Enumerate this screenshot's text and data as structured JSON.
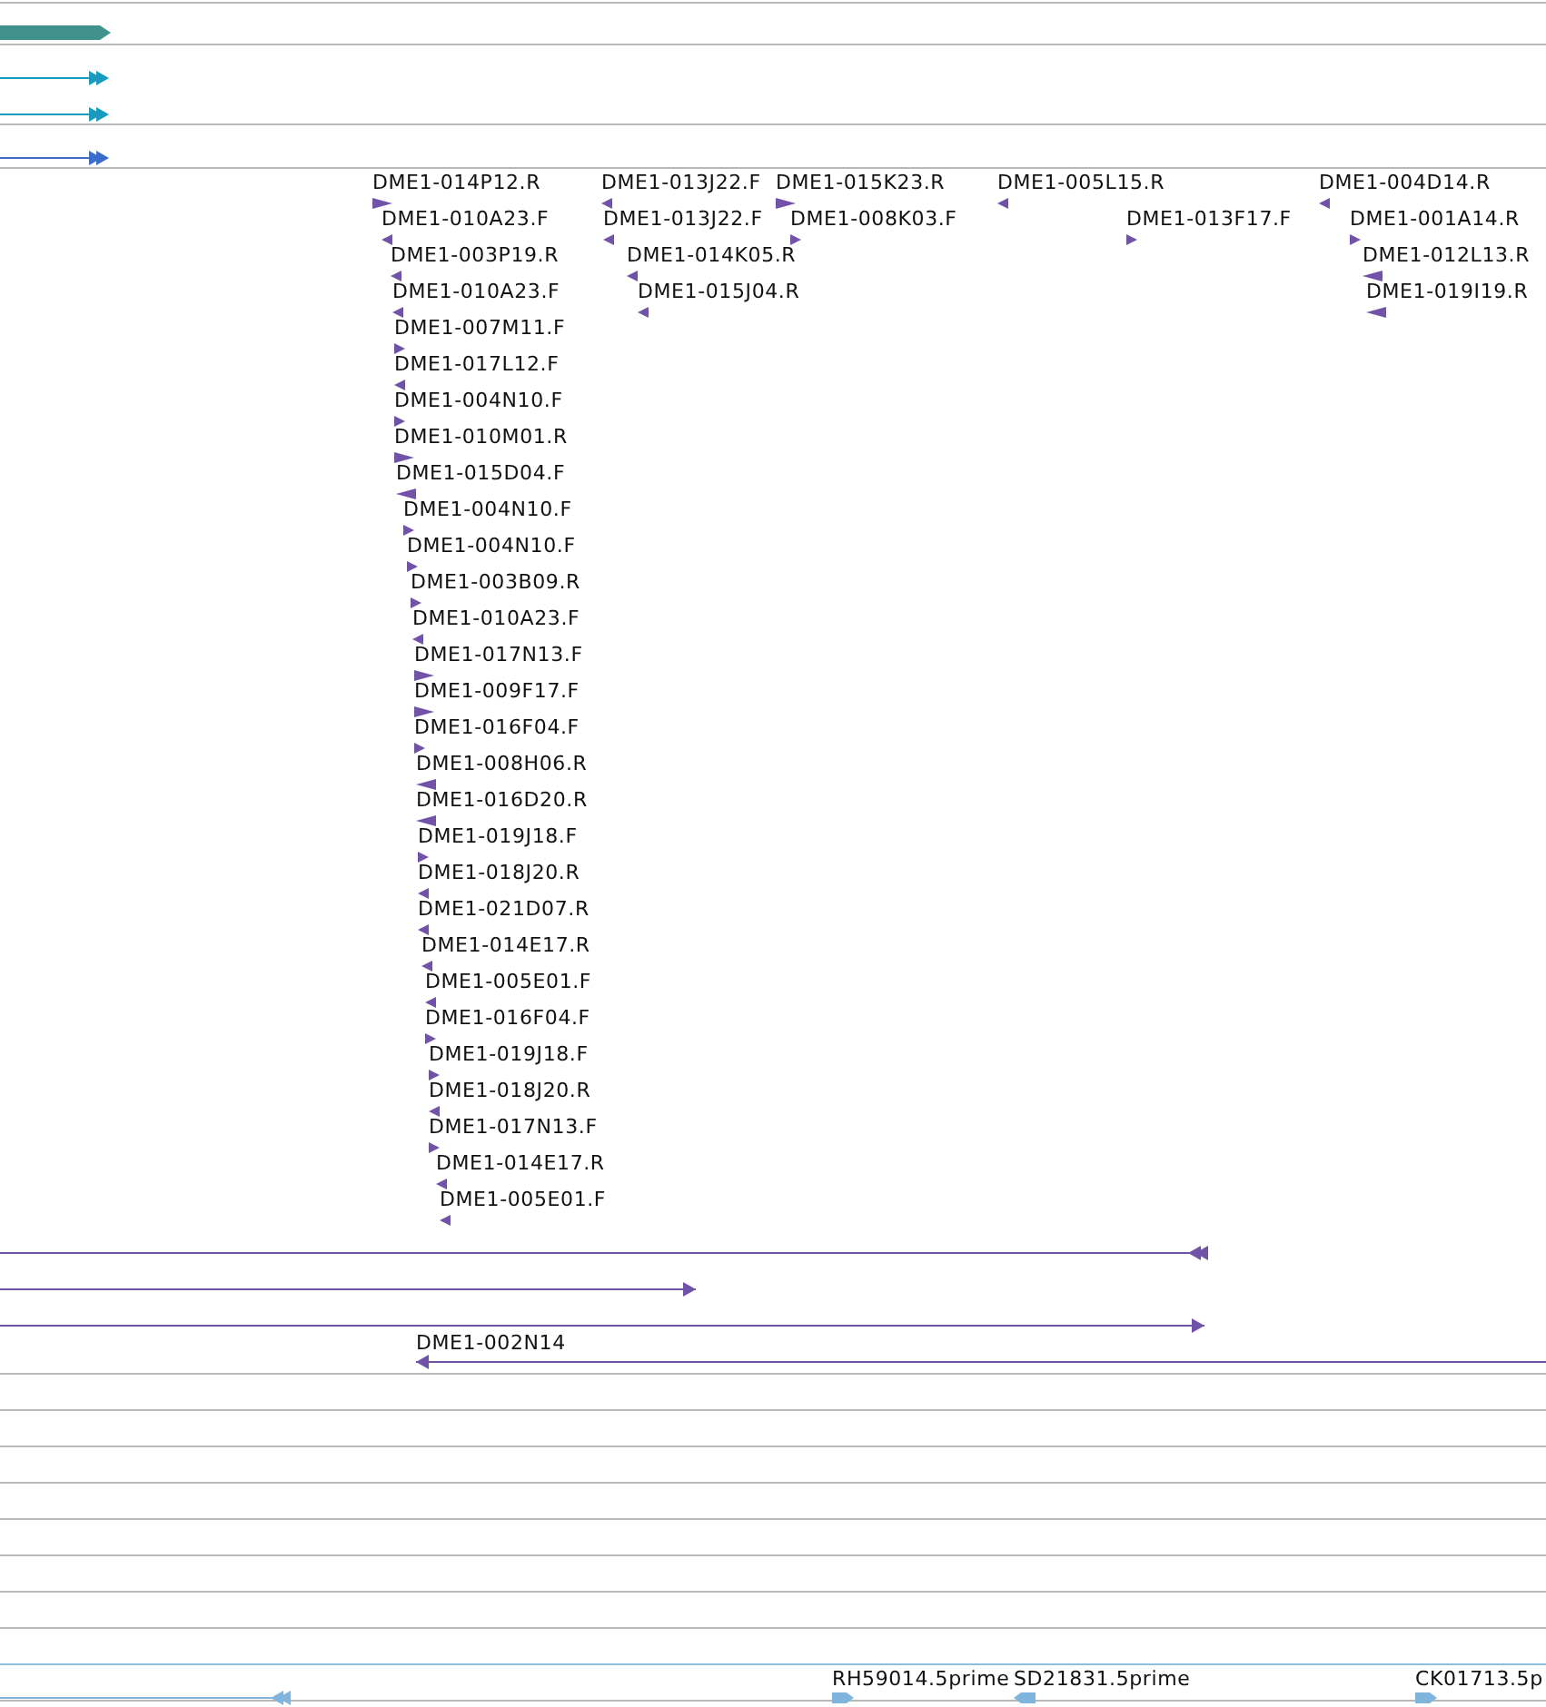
{
  "top_tracks": [
    {
      "kind": "block",
      "reverse": false,
      "color": "#41918f"
    },
    {
      "kind": "line",
      "reverse": false,
      "color": "#1b9ac0"
    },
    {
      "kind": "line",
      "reverse": false,
      "color": "#1b9ac0"
    },
    {
      "kind": "line",
      "reverse": false,
      "color": "#3a6ccc"
    }
  ],
  "clones": [
    {
      "label": "DME1-014P12.R",
      "reverse": false
    },
    {
      "label": "DME1-010A23.F",
      "reverse": true
    },
    {
      "label": "DME1-003P19.R",
      "reverse": true
    },
    {
      "label": "DME1-010A23.F",
      "reverse": true
    },
    {
      "label": "DME1-007M11.F",
      "reverse": false
    },
    {
      "label": "DME1-017L12.F",
      "reverse": true
    },
    {
      "label": "DME1-004N10.F",
      "reverse": false
    },
    {
      "label": "DME1-010M01.R",
      "reverse": false
    },
    {
      "label": "DME1-015D04.F",
      "reverse": true
    },
    {
      "label": "DME1-004N10.F",
      "reverse": false
    },
    {
      "label": "DME1-004N10.F",
      "reverse": false
    },
    {
      "label": "DME1-003B09.R",
      "reverse": false
    },
    {
      "label": "DME1-010A23.F",
      "reverse": true
    },
    {
      "label": "DME1-017N13.F",
      "reverse": false
    },
    {
      "label": "DME1-009F17.F",
      "reverse": false
    },
    {
      "label": "DME1-016F04.F",
      "reverse": false
    },
    {
      "label": "DME1-008H06.R",
      "reverse": true
    },
    {
      "label": "DME1-016D20.R",
      "reverse": true
    },
    {
      "label": "DME1-019J18.F",
      "reverse": false
    },
    {
      "label": "DME1-018J20.R",
      "reverse": true
    },
    {
      "label": "DME1-021D07.R",
      "reverse": true
    },
    {
      "label": "DME1-014E17.R",
      "reverse": true
    },
    {
      "label": "DME1-005E01.F",
      "reverse": true
    },
    {
      "label": "DME1-016F04.F",
      "reverse": false
    },
    {
      "label": "DME1-019J18.F",
      "reverse": false
    },
    {
      "label": "DME1-018J20.R",
      "reverse": true
    },
    {
      "label": "DME1-017N13.F",
      "reverse": false
    },
    {
      "label": "DME1-014E17.R",
      "reverse": true
    },
    {
      "label": "DME1-005E01.F",
      "reverse": true
    },
    {
      "label": "DME1-013J22.F",
      "reverse": true
    },
    {
      "label": "DME1-015K23.R",
      "reverse": false
    },
    {
      "label": "DME1-013J22.F",
      "reverse": true
    },
    {
      "label": "DME1-008K03.F",
      "reverse": false
    },
    {
      "label": "DME1-014K05.R",
      "reverse": true
    },
    {
      "label": "DME1-015J04.R",
      "reverse": true
    },
    {
      "label": "DME1-005L15.R",
      "reverse": true
    },
    {
      "label": "DME1-013F17.F",
      "reverse": false
    },
    {
      "label": "DME1-004D14.R",
      "reverse": true
    },
    {
      "label": "DME1-001A14.R",
      "reverse": false
    },
    {
      "label": "DME1-012L13.R",
      "reverse": true
    },
    {
      "label": "DME1-019I19.R",
      "reverse": true
    }
  ],
  "alignments": [
    {
      "reverse": true
    },
    {
      "reverse": false
    },
    {
      "reverse": false
    },
    {
      "label": "DME1-002N14",
      "reverse": true
    }
  ],
  "ests": [
    {
      "reverse": true
    },
    {
      "label": "RH59014.5prime",
      "reverse": false
    },
    {
      "label": "SD21831.5prime",
      "reverse": true
    },
    {
      "label": "CK01713.5p",
      "reverse": false
    }
  ]
}
